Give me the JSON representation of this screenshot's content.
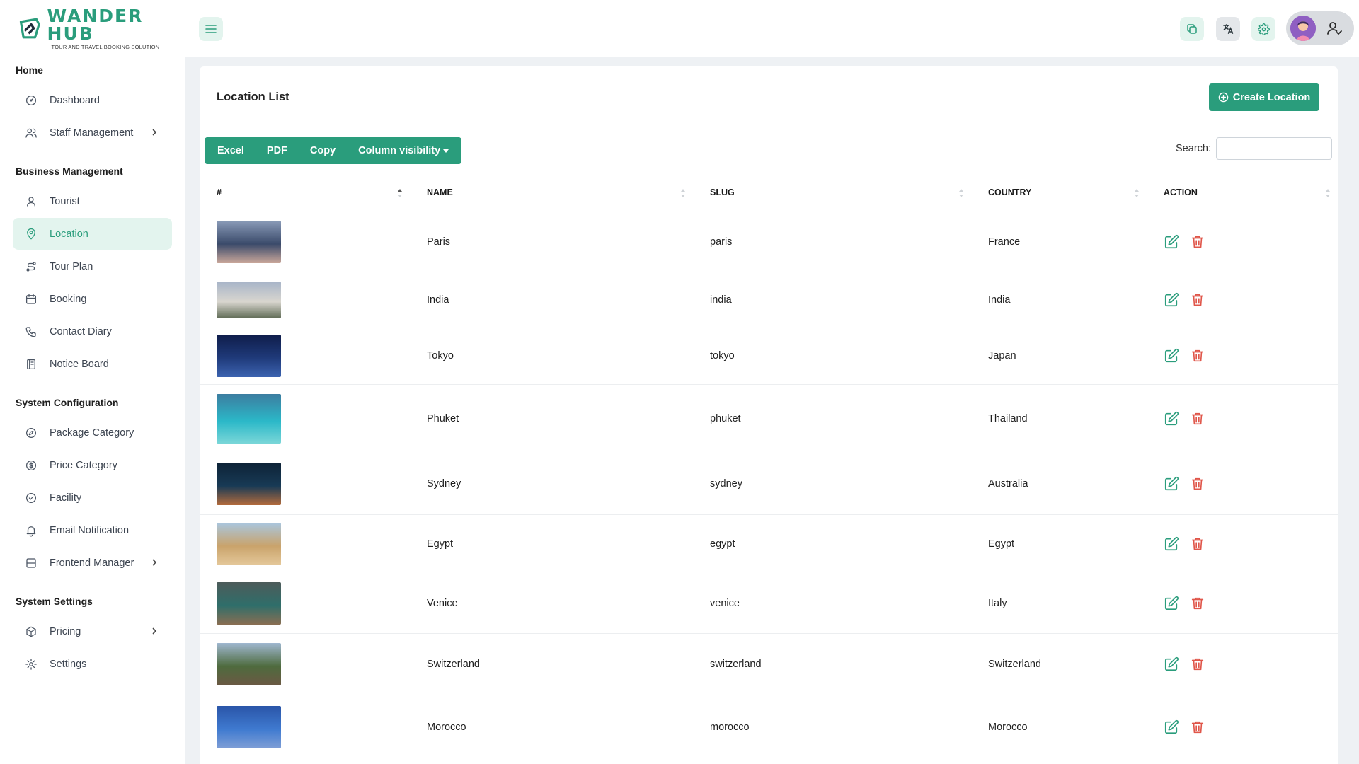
{
  "brand": {
    "name": "WANDER HUB",
    "tagline": "TOUR AND TRAVEL BOOKING SOLUTION"
  },
  "colors": {
    "accent": "#2a9d7c",
    "accent_light": "#e3f4ee",
    "danger": "#e0564a"
  },
  "sidebar": {
    "sections": [
      {
        "title": "Home",
        "items": [
          {
            "label": "Dashboard",
            "icon": "dashboard-gauge-icon",
            "active": false,
            "expandable": false
          },
          {
            "label": "Staff Management",
            "icon": "users-icon",
            "active": false,
            "expandable": true
          }
        ]
      },
      {
        "title": "Business Management",
        "items": [
          {
            "label": "Tourist",
            "icon": "user-icon",
            "active": false,
            "expandable": false
          },
          {
            "label": "Location",
            "icon": "map-pin-icon",
            "active": true,
            "expandable": false
          },
          {
            "label": "Tour Plan",
            "icon": "route-icon",
            "active": false,
            "expandable": false
          },
          {
            "label": "Booking",
            "icon": "calendar-icon",
            "active": false,
            "expandable": false
          },
          {
            "label": "Contact Diary",
            "icon": "phone-icon",
            "active": false,
            "expandable": false
          },
          {
            "label": "Notice Board",
            "icon": "notice-icon",
            "active": false,
            "expandable": false
          }
        ]
      },
      {
        "title": "System Configuration",
        "items": [
          {
            "label": "Package Category",
            "icon": "compass-icon",
            "active": false,
            "expandable": false
          },
          {
            "label": "Price Category",
            "icon": "dollar-circle-icon",
            "active": false,
            "expandable": false
          },
          {
            "label": "Facility",
            "icon": "check-circle-icon",
            "active": false,
            "expandable": false
          },
          {
            "label": "Email Notification",
            "icon": "bell-icon",
            "active": false,
            "expandable": false
          },
          {
            "label": "Frontend Manager",
            "icon": "layout-icon",
            "active": false,
            "expandable": true
          }
        ]
      },
      {
        "title": "System Settings",
        "items": [
          {
            "label": "Pricing",
            "icon": "box-icon",
            "active": false,
            "expandable": true
          },
          {
            "label": "Settings",
            "icon": "gear-icon",
            "active": false,
            "expandable": false
          }
        ]
      }
    ]
  },
  "topbar": {
    "icons": [
      "menu-icon",
      "copy-icon",
      "translate-icon",
      "gear-icon",
      "user-avatar",
      "user-check-icon"
    ]
  },
  "card": {
    "title": "Location List",
    "create_button": "Create Location",
    "export_buttons": [
      "Excel",
      "PDF",
      "Copy",
      "Column visibility"
    ],
    "search_label": "Search:",
    "search_value": "",
    "columns": [
      "#",
      "NAME",
      "SLUG",
      "COUNTRY",
      "ACTION"
    ],
    "rows": [
      {
        "name": "Paris",
        "slug": "paris",
        "country": "France",
        "thumb": [
          "#8a9bb8",
          "#3a4a6a",
          "#c9a79a"
        ]
      },
      {
        "name": "India",
        "slug": "india",
        "country": "India",
        "thumb": [
          "#a7b4c8",
          "#d9d6cf",
          "#5f6b55"
        ]
      },
      {
        "name": "Tokyo",
        "slug": "tokyo",
        "country": "Japan",
        "thumb": [
          "#0f1d4a",
          "#1f3a7a",
          "#3c63b0"
        ]
      },
      {
        "name": "Phuket",
        "slug": "phuket",
        "country": "Thailand",
        "thumb": [
          "#3c7da0",
          "#2bb8c8",
          "#7ad6d8"
        ]
      },
      {
        "name": "Sydney",
        "slug": "sydney",
        "country": "Australia",
        "thumb": [
          "#0d2236",
          "#183a55",
          "#b36b3c"
        ]
      },
      {
        "name": "Egypt",
        "slug": "egypt",
        "country": "Egypt",
        "thumb": [
          "#a9c6de",
          "#c9a36b",
          "#e4c89a"
        ]
      },
      {
        "name": "Venice",
        "slug": "venice",
        "country": "Italy",
        "thumb": [
          "#4d5b5a",
          "#2f6e6a",
          "#8a6e52"
        ]
      },
      {
        "name": "Switzerland",
        "slug": "switzerland",
        "country": "Switzerland",
        "thumb": [
          "#9fb7d0",
          "#4e6b3e",
          "#6b5843"
        ]
      },
      {
        "name": "Morocco",
        "slug": "morocco",
        "country": "Morocco",
        "thumb": [
          "#2a55a8",
          "#3f7ad0",
          "#7f9ed6"
        ]
      }
    ]
  }
}
